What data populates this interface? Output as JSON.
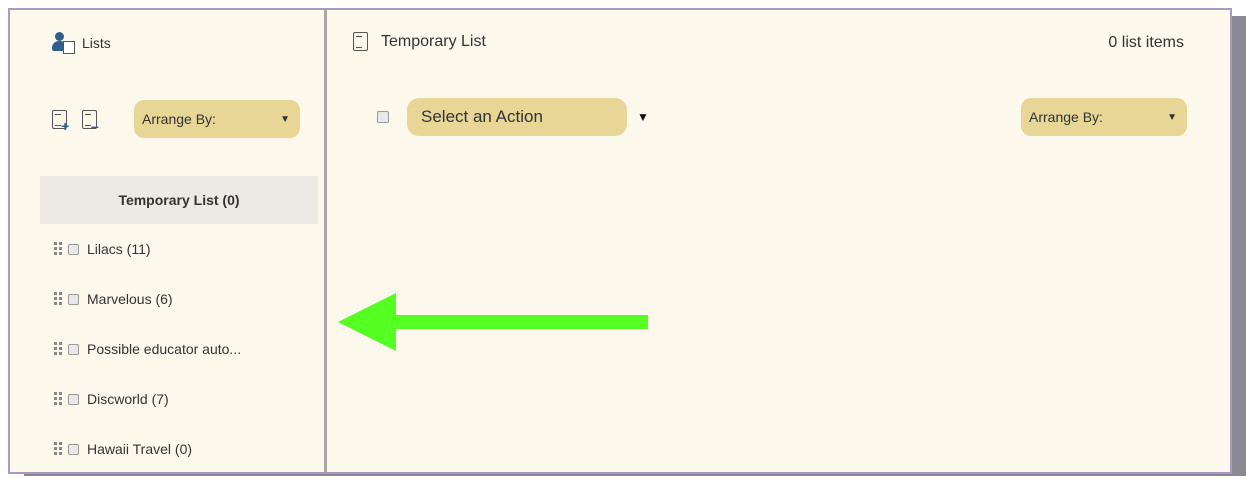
{
  "sidebar": {
    "title": "Lists",
    "arrange_label": "Arrange By:",
    "items": [
      {
        "label": "Temporary List (0)",
        "active": true
      },
      {
        "label": "Lilacs (11)"
      },
      {
        "label": "Marvelous (6)"
      },
      {
        "label": "Possible educator auto..."
      },
      {
        "label": "Discworld (7)"
      },
      {
        "label": "Hawaii Travel (0)"
      }
    ]
  },
  "main": {
    "title": "Temporary List",
    "count": "0 list items",
    "action_label": "Select an Action",
    "arrange_label": "Arrange By:"
  },
  "icons": {
    "lists": "user-list-icon",
    "add_list": "add-list-icon",
    "remove_list": "remove-list-icon",
    "list_doc": "list-doc-icon",
    "drag": "drag-handle-icon",
    "caret": "caret-down-icon"
  },
  "colors": {
    "panel_bg": "#fcf9ec",
    "dropdown_bg": "#e8d696",
    "active_bg": "#ede9e4",
    "arrow": "#55ff22",
    "accent": "#2e5f8e"
  }
}
